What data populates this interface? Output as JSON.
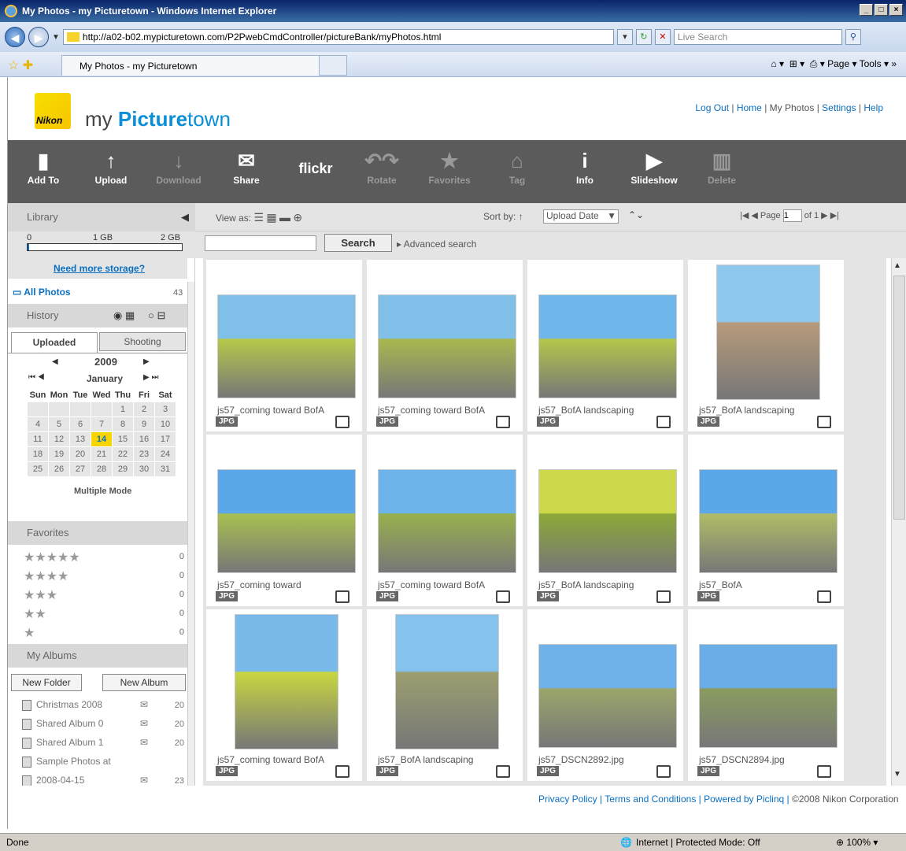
{
  "window": {
    "title": "My Photos - my Picturetown - Windows Internet Explorer"
  },
  "address": {
    "url": "http://a02-b02.mypicturetown.com/P2PwebCmdController/pictureBank/myPhotos.html",
    "search_placeholder": "Live Search"
  },
  "tab": {
    "label": "My Photos - my Picturetown",
    "page_menu": "Page",
    "tools_menu": "Tools"
  },
  "brand": {
    "logo": "Nikon",
    "my": "my ",
    "picture": "Picture",
    "town": "town"
  },
  "toplinks": [
    "Log Out",
    "Home",
    "My Photos",
    "Settings",
    "Help"
  ],
  "toolbar": [
    "Add To",
    "Upload",
    "Download",
    "Share",
    "flickr",
    "Rotate",
    "Favorites",
    "Tag",
    "Info",
    "Slideshow",
    "Delete"
  ],
  "library": {
    "heading": "Library",
    "storage_0": "0",
    "storage_1": "1 GB",
    "storage_2": "2 GB",
    "need_more": "Need more storage?",
    "all_photos": "All Photos",
    "all_count": "43"
  },
  "viewbar": {
    "view_as": "View as:",
    "sort_by": "Sort by:",
    "sort_value": "Upload Date",
    "page_label": "Page",
    "page_value": "1",
    "of": "of 1"
  },
  "search": {
    "button": "Search",
    "advanced": "Advanced search"
  },
  "history": {
    "heading": "History",
    "tab_uploaded": "Uploaded",
    "tab_shooting": "Shooting",
    "year": "2009",
    "month": "January",
    "multiple_mode": "Multiple Mode",
    "days": [
      "Sun",
      "Mon",
      "Tue",
      "Wed",
      "Thu",
      "Fri",
      "Sat"
    ],
    "rows": [
      [
        "",
        "",
        "",
        "",
        "1",
        "2",
        "3"
      ],
      [
        "4",
        "5",
        "6",
        "7",
        "8",
        "9",
        "10"
      ],
      [
        "11",
        "12",
        "13",
        "14",
        "15",
        "16",
        "17"
      ],
      [
        "18",
        "19",
        "20",
        "21",
        "22",
        "23",
        "24"
      ],
      [
        "25",
        "26",
        "27",
        "28",
        "29",
        "30",
        "31"
      ]
    ]
  },
  "favorites": {
    "heading": "Favorites",
    "rows": [
      {
        "stars": "★★★★★",
        "count": "0"
      },
      {
        "stars": "★★★★",
        "count": "0"
      },
      {
        "stars": "★★★",
        "count": "0"
      },
      {
        "stars": "★★",
        "count": "0"
      },
      {
        "stars": "★",
        "count": "0"
      }
    ]
  },
  "albums": {
    "heading": "My Albums",
    "new_folder": "New Folder",
    "new_album": "New Album",
    "items": [
      {
        "name": "Christmas 2008",
        "count": "20"
      },
      {
        "name": "Shared Album 0",
        "count": "20"
      },
      {
        "name": "Shared Album 1",
        "count": "20"
      },
      {
        "name": "Sample Photos at",
        "count": ""
      },
      {
        "name": "2008-04-15",
        "count": "23"
      }
    ]
  },
  "photos": [
    {
      "name": "js57_coming toward BofA",
      "type": "JPG"
    },
    {
      "name": "js57_coming toward BofA",
      "type": "JPG"
    },
    {
      "name": "js57_BofA landscaping",
      "type": "JPG"
    },
    {
      "name": "js57_BofA landscaping",
      "type": "JPG"
    },
    {
      "name": "js57_coming toward",
      "type": "JPG"
    },
    {
      "name": "js57_coming toward BofA",
      "type": "JPG"
    },
    {
      "name": "js57_BofA landscaping",
      "type": "JPG"
    },
    {
      "name": "js57_BofA",
      "type": "JPG"
    },
    {
      "name": "js57_coming toward BofA",
      "type": "JPG"
    },
    {
      "name": "js57_BofA landscaping",
      "type": "JPG"
    },
    {
      "name": "js57_DSCN2892.jpg",
      "type": "JPG"
    },
    {
      "name": "js57_DSCN2894.jpg",
      "type": "JPG"
    }
  ],
  "footer": {
    "privacy": "Privacy Policy",
    "terms": "Terms and Conditions",
    "powered": "Powered by Piclinq",
    "copyright": "©2008 Nikon Corporation"
  },
  "status": {
    "left": "Done",
    "zone": "Internet | Protected Mode: Off",
    "zoom": "100%"
  }
}
